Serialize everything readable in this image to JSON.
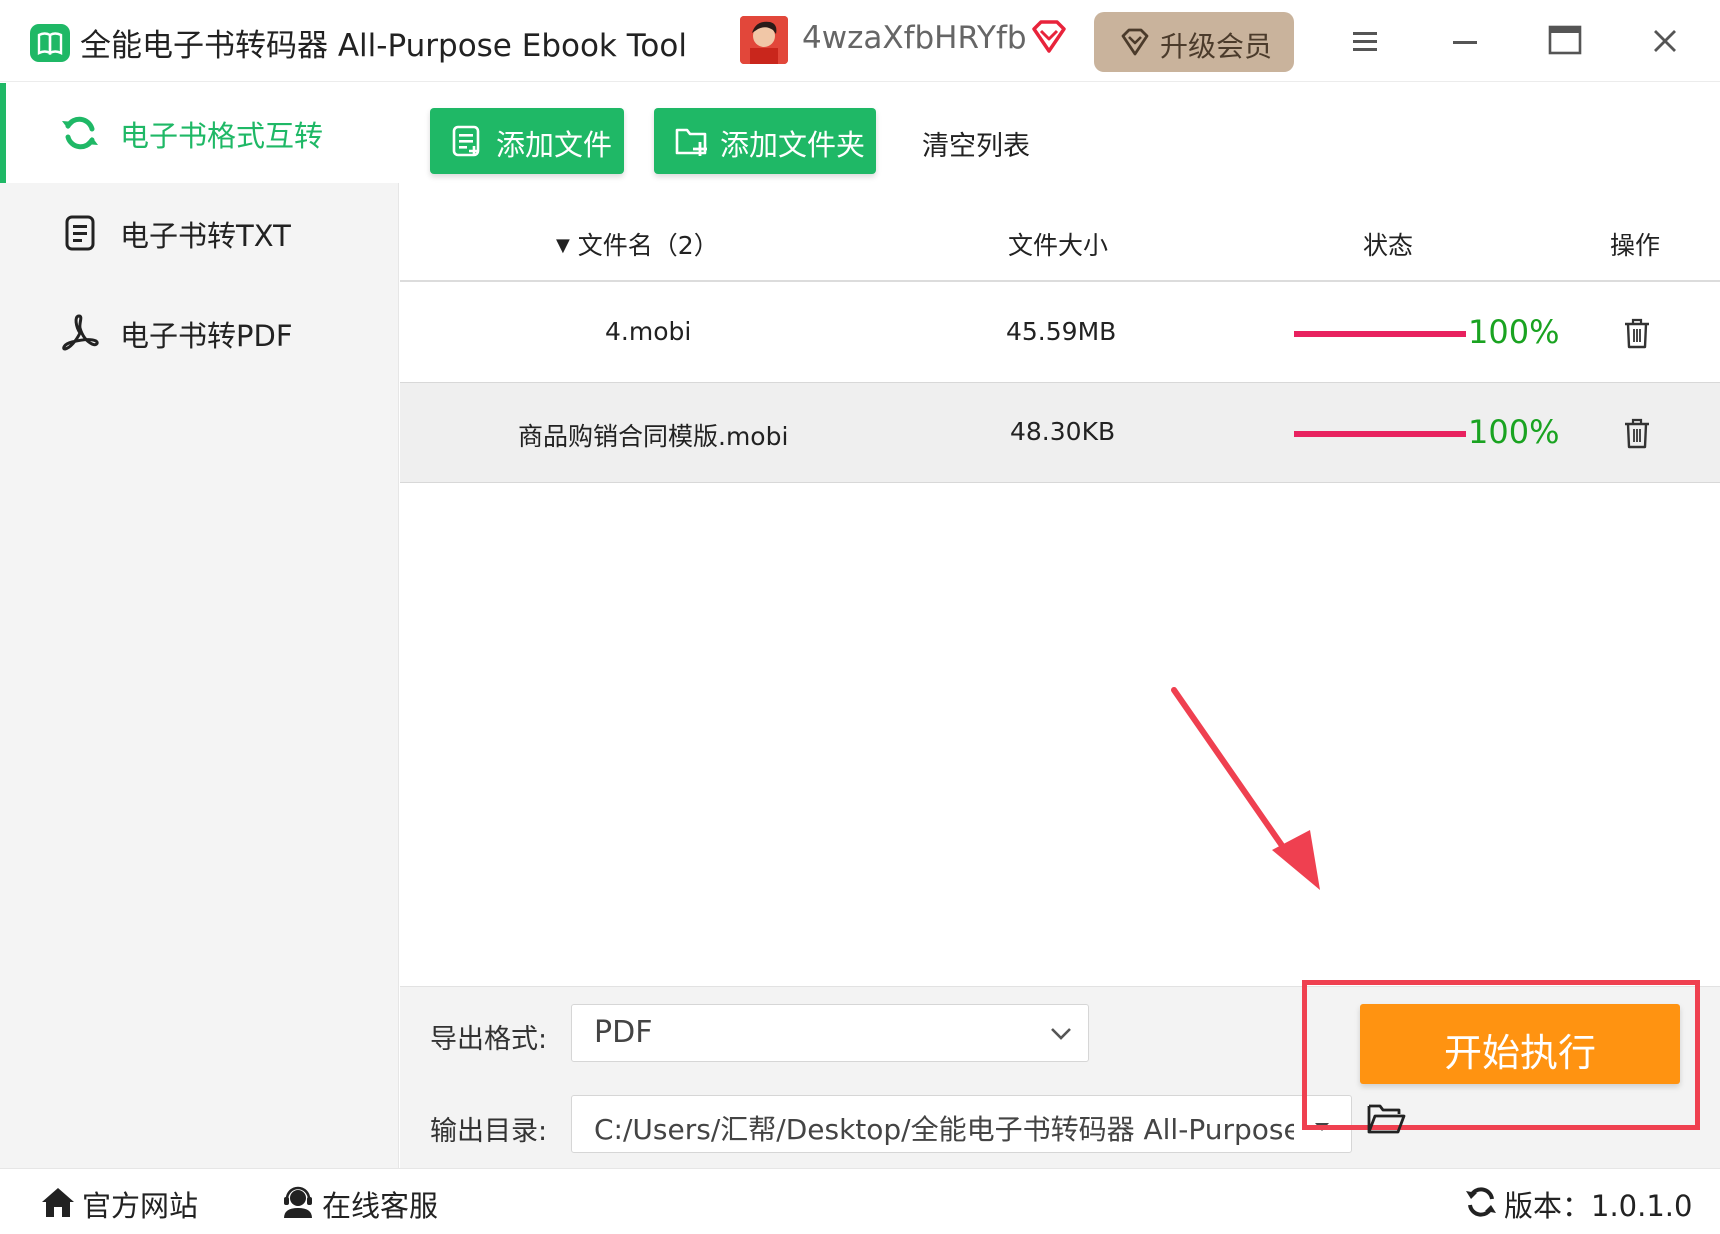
{
  "titlebar": {
    "app_title": "全能电子书转码器 All-Purpose Ebook Tool",
    "username": "4wzaXfbHRYfb",
    "upgrade_label": "升级会员"
  },
  "sidebar": {
    "items": [
      {
        "label": "电子书格式互转",
        "icon": "refresh-icon",
        "active": true
      },
      {
        "label": "电子书转TXT",
        "icon": "document-icon",
        "active": false
      },
      {
        "label": "电子书转PDF",
        "icon": "pdf-icon",
        "active": false
      }
    ]
  },
  "toolbar": {
    "add_file_label": "添加文件",
    "add_folder_label": "添加文件夹",
    "clear_label": "清空列表"
  },
  "table": {
    "headers": {
      "filename": "文件名（2）",
      "size": "文件大小",
      "status": "状态",
      "action": "操作"
    },
    "rows": [
      {
        "name": "4.mobi",
        "size": "45.59MB",
        "progress": 100,
        "percent": "100%"
      },
      {
        "name": "商品购销合同模版.mobi",
        "size": "48.30KB",
        "progress": 100,
        "percent": "100%"
      }
    ]
  },
  "bottom": {
    "format_label": "导出格式:",
    "format_value": "PDF",
    "output_label": "输出目录:",
    "output_value": "C:/Users/汇帮/Desktop/全能电子书转码器 All-Purpose Ebook Tool",
    "start_label": "开始执行"
  },
  "footer": {
    "website_label": "官方网站",
    "support_label": "在线客服",
    "version_label": "版本：1.0.1.0"
  },
  "colors": {
    "accent_green": "#1fb866",
    "start_orange": "#ff9311",
    "progress_pink": "#e8225f",
    "percent_green": "#1aa321",
    "annotation_red": "#ef4050"
  }
}
